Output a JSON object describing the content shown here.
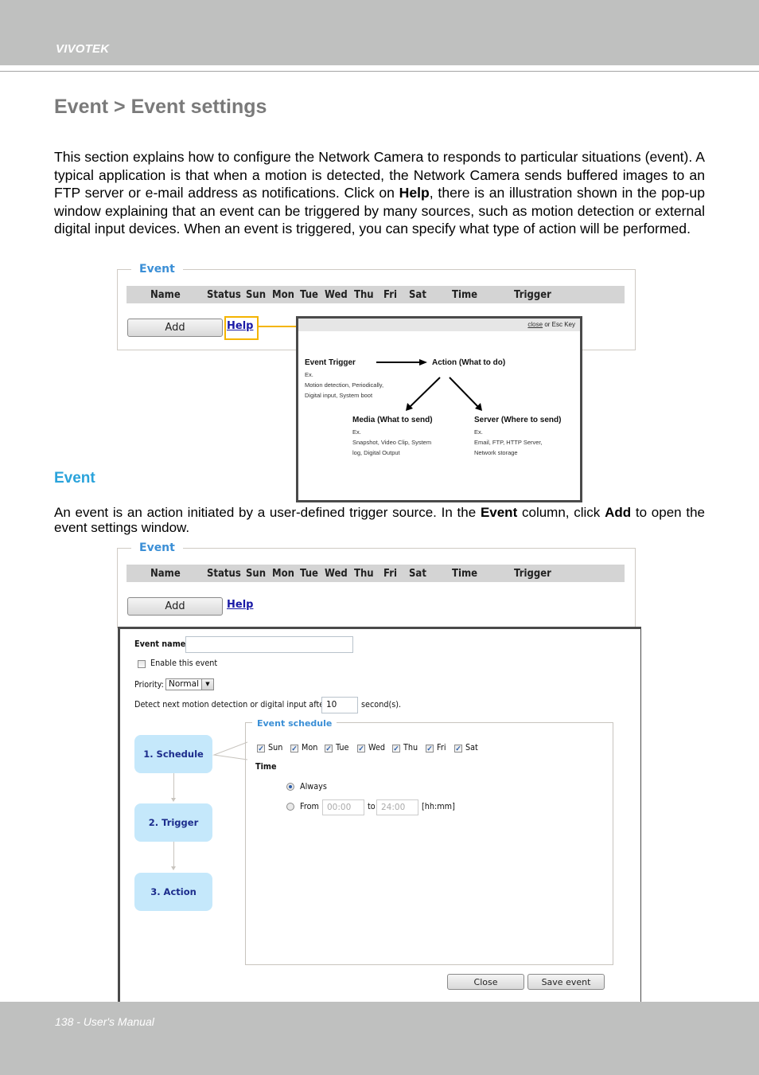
{
  "header": {
    "brand": "VIVOTEK"
  },
  "page": {
    "title": "Event > Event settings",
    "intro_parts": [
      "This section explains how to configure the Network Camera to responds to particular situations (event). A typical application is that when a motion is detected, the Network Camera sends buffered images to an FTP server or e-mail address as notifications. Click on ",
      "Help",
      ", there is an illustration shown in the pop-up window explaining that an event can be triggered by many sources, such as motion detection or external digital input devices. When an event is triggered, you can specify what type of action will be performed."
    ],
    "section_heading": "Event",
    "event_para_parts": [
      "An event is an action initiated by a user-defined trigger source. In the ",
      "Event",
      " column, click ",
      "Add",
      " to open the event settings window."
    ]
  },
  "event_panel": {
    "legend": "Event",
    "columns": [
      "Name",
      "Status",
      "Sun",
      "Mon",
      "Tue",
      "Wed",
      "Thu",
      "Fri",
      "Sat",
      "Time",
      "Trigger"
    ],
    "add_label": "Add",
    "help_label": "Help"
  },
  "help_popup": {
    "close_link": "close",
    "close_suffix": " or Esc Key",
    "trigger_title": "Event Trigger",
    "trigger_ex": "Ex.",
    "trigger_lines": [
      "Motion detection, Periodically,",
      "Digital input, System boot"
    ],
    "action_title": "Action (What to do)",
    "media_title": "Media (What to send)",
    "media_ex": "Ex.",
    "media_lines": [
      "Snapshot, Video Clip, System",
      "log, Digital Output"
    ],
    "server_title": "Server (Where to send)",
    "server_ex": "Ex.",
    "server_lines": [
      "Email, FTP, HTTP Server,",
      "Network storage"
    ]
  },
  "settings_dialog": {
    "event_name_label": "Event name:",
    "event_name_value": "",
    "enable_label": "Enable this event",
    "enable_checked": false,
    "priority_label": "Priority:",
    "priority_value": "Normal",
    "detect_label": "Detect next motion detection or digital input after",
    "detect_value": "10",
    "detect_unit": "second(s).",
    "steps": [
      "1.  Schedule",
      "2.  Trigger",
      "3.  Action"
    ],
    "schedule_legend": "Event schedule",
    "days": [
      {
        "label": "Sun",
        "checked": true
      },
      {
        "label": "Mon",
        "checked": true
      },
      {
        "label": "Tue",
        "checked": true
      },
      {
        "label": "Wed",
        "checked": true
      },
      {
        "label": "Thu",
        "checked": true
      },
      {
        "label": "Fri",
        "checked": true
      },
      {
        "label": "Sat",
        "checked": true
      }
    ],
    "time_label": "Time",
    "always_label": "Always",
    "always_selected": true,
    "from_label": "From",
    "from_value": "00:00",
    "to_label": "to",
    "to_value": "24:00",
    "time_format": "[hh:mm]",
    "close_label": "Close",
    "save_label": "Save event"
  },
  "footer": {
    "page_label": "138 - User's Manual"
  },
  "colors": {
    "accent_blue": "#2aa3db",
    "highlight": "#f4b400",
    "bar_gray": "#bfc0bf",
    "step_fill": "#c5e8fb"
  }
}
